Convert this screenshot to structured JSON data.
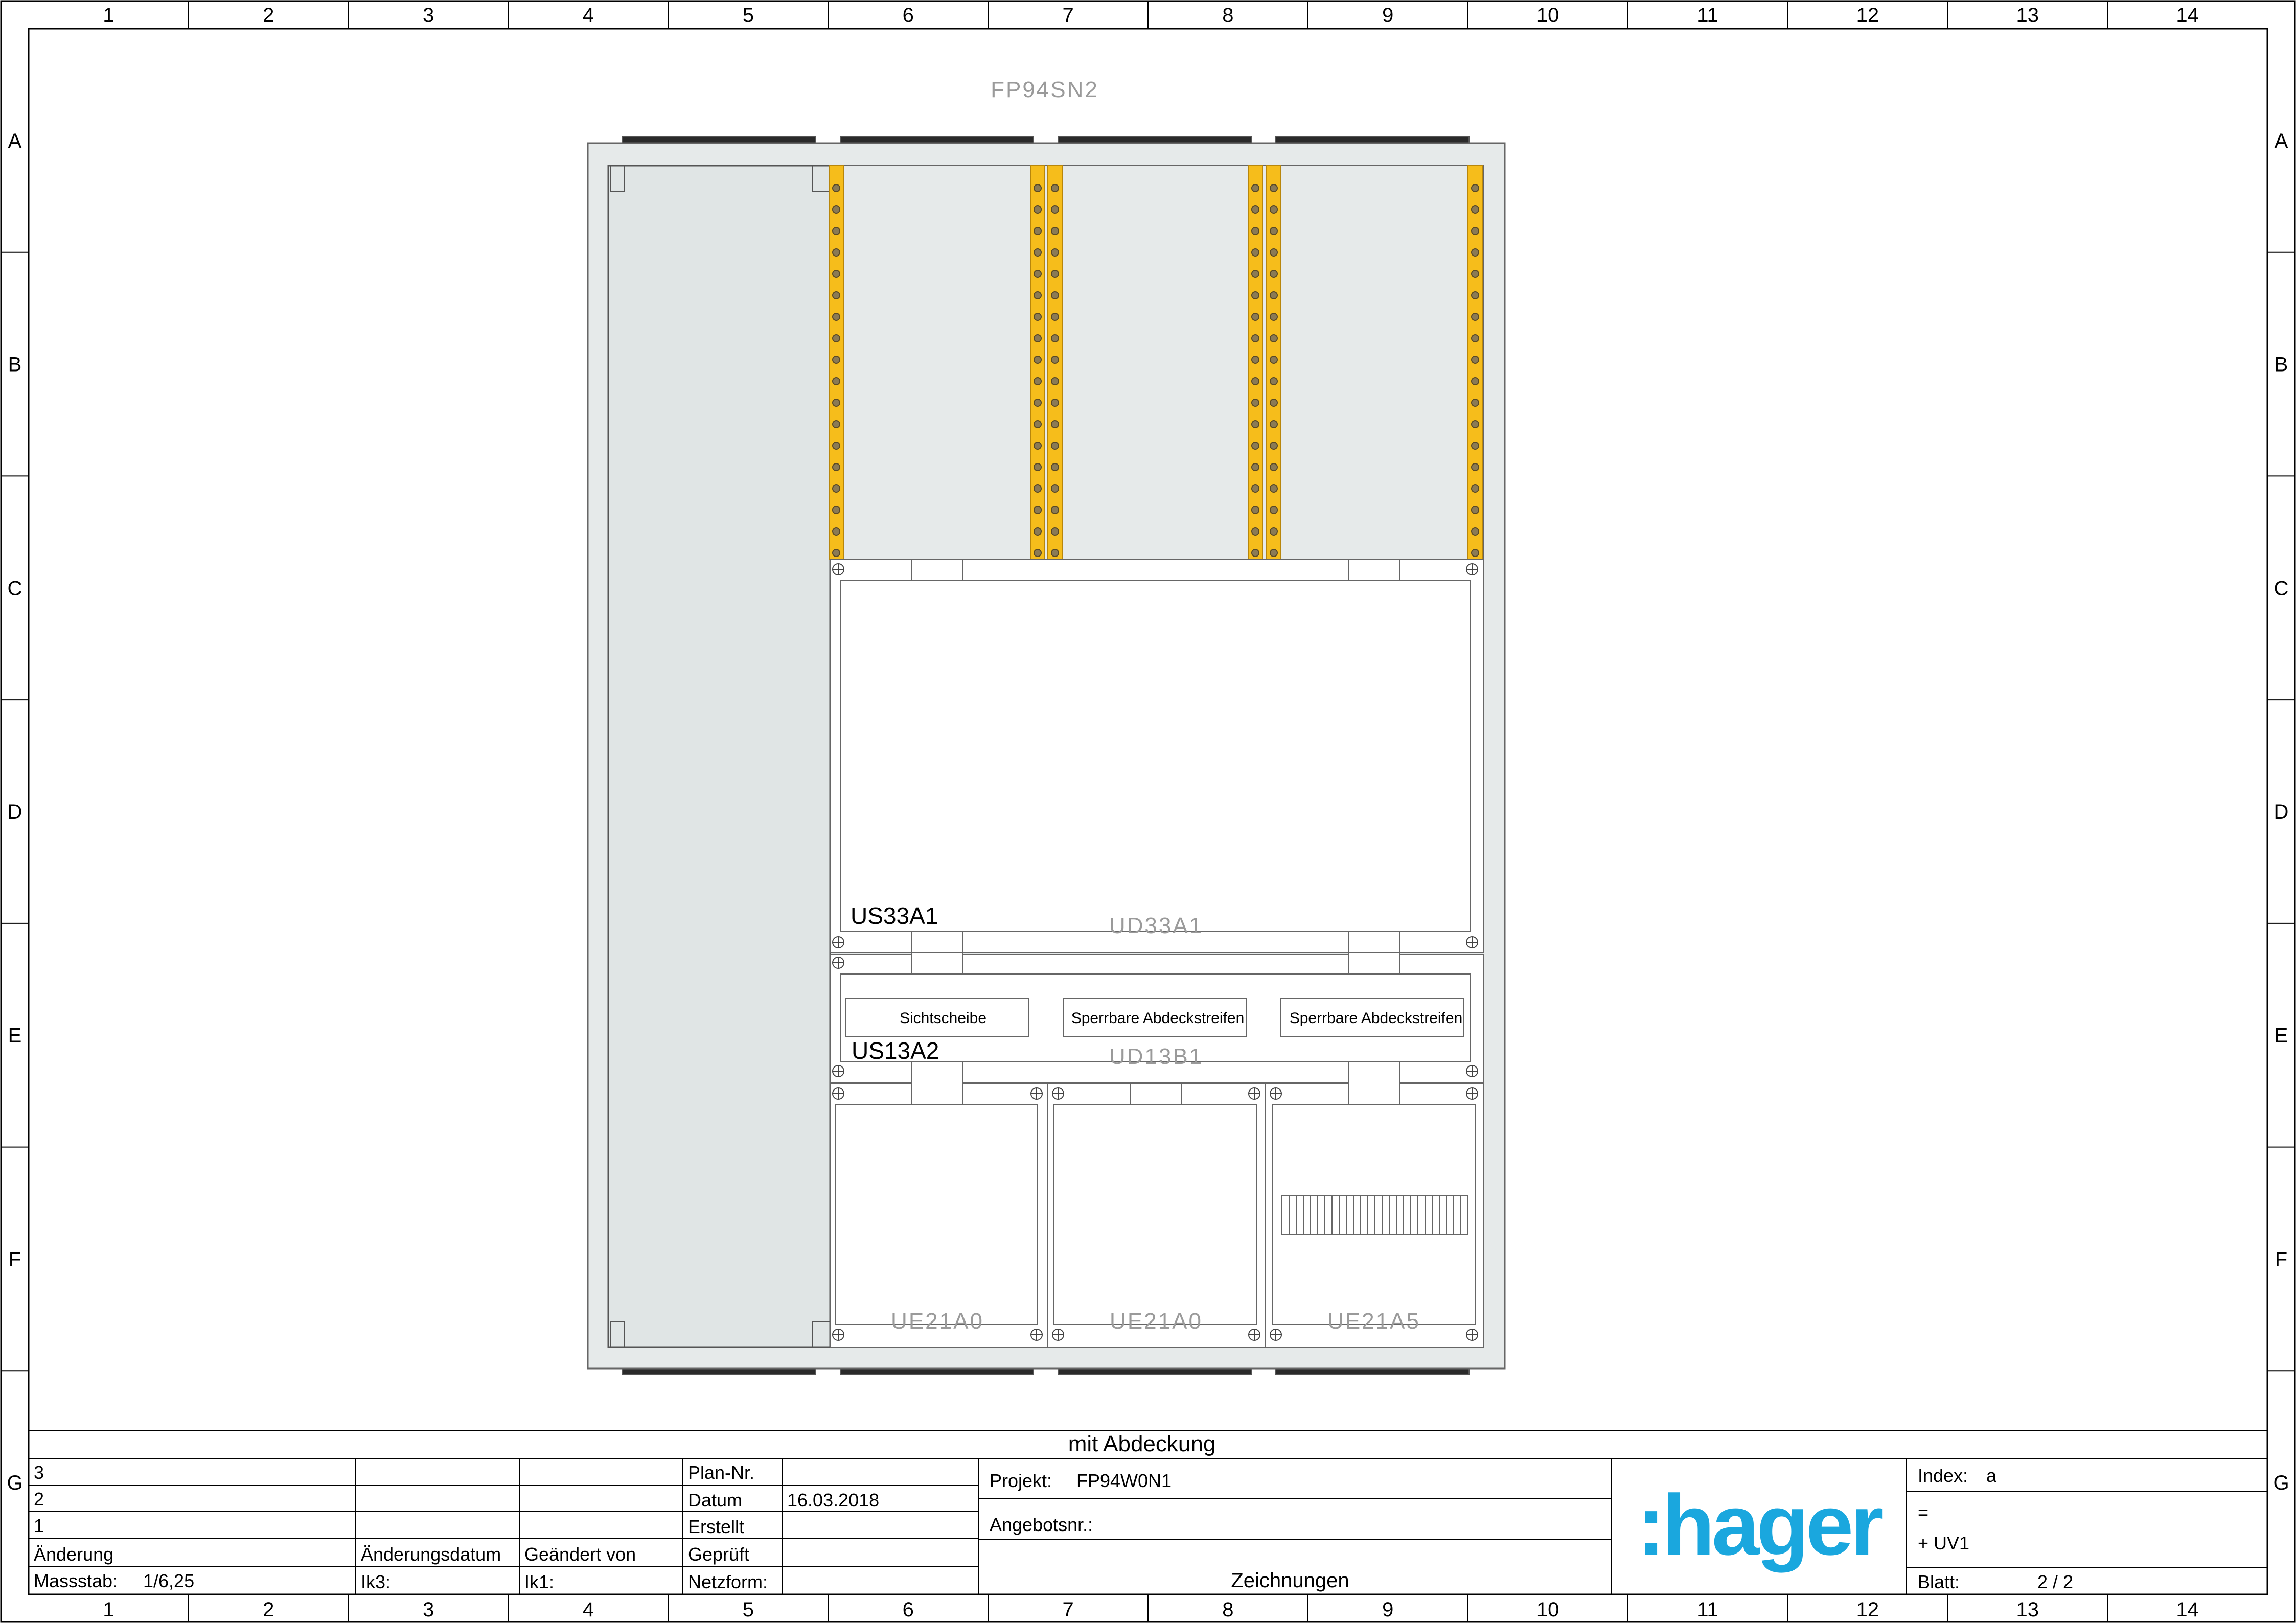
{
  "grid": {
    "columns": [
      "1",
      "2",
      "3",
      "4",
      "5",
      "6",
      "7",
      "8",
      "9",
      "10",
      "11",
      "12",
      "13",
      "14"
    ],
    "rows": [
      "A",
      "B",
      "C",
      "D",
      "E",
      "F",
      "G"
    ]
  },
  "enclosure": {
    "title": "FP94SN2",
    "modules": {
      "us33a1": "US33A1",
      "ud33a1": "UD33A1",
      "us13a2": "US13A2",
      "ud13b1": "UD13B1",
      "ue21a0_1": "UE21A0",
      "ue21a0_2": "UE21A0",
      "ue21a5": "UE21A5"
    },
    "strips": {
      "sichtscheibe": "Sichtscheibe",
      "sperrbar_1": "Sperrbare Abdeckstreifen",
      "sperrbar_2": "Sperrbare Abdeckstreifen"
    }
  },
  "titleblock": {
    "caption": "mit Abdeckung",
    "revisions": [
      "3",
      "2",
      "1"
    ],
    "aenderung": "Änderung",
    "aenderungsdatum": "Änderungsdatum",
    "geaendert_von": "Geändert von",
    "massstab_label": "Massstab:",
    "massstab_value": "1/6,25",
    "ik3": "Ik3:",
    "ik1": "Ik1:",
    "plan_nr": "Plan-Nr.",
    "datum_label": "Datum",
    "datum_value": "16.03.2018",
    "erstellt": "Erstellt",
    "geprueft": "Geprüft",
    "netzform": "Netzform:",
    "projekt_label": "Projekt:",
    "projekt_value": "FP94W0N1",
    "angebotsnr": "Angebotsnr.:",
    "zeichnungen": "Zeichnungen",
    "logo": ":hager",
    "index_label": "Index:",
    "index_value": "a",
    "eq": "=",
    "uv": "+ UV1",
    "blatt_label": "Blatt:",
    "blatt_value": "2 / 2"
  },
  "colors": {
    "busbar": "#f6bd1b",
    "brand": "#1aa7de",
    "panel": "#e6eaea"
  }
}
